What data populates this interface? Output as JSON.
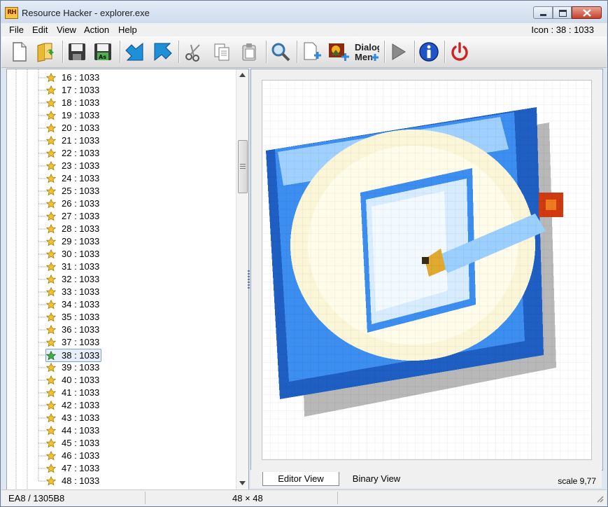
{
  "window": {
    "title": "Resource Hacker - explorer.exe",
    "app_icon_text": "RH"
  },
  "menu": {
    "items": [
      "File",
      "Edit",
      "View",
      "Action",
      "Help"
    ],
    "selection_info": "Icon : 38 : 1033"
  },
  "toolbar": {
    "buttons": [
      "new-file-icon",
      "open-folder-icon",
      "save-icon",
      "save-as-icon",
      "back-arrow-icon",
      "forward-arrow-icon",
      "cut-icon",
      "copy-icon",
      "paste-icon",
      "search-icon",
      "add-resource-icon",
      "add-image-resource-icon",
      "dialog-menu-icon",
      "run-script-icon",
      "info-icon",
      "power-icon"
    ],
    "save_as_label": "As",
    "dialog_menu_label_1": "Dialog",
    "dialog_menu_label_2": "Men"
  },
  "tree": {
    "items": [
      "16 : 1033",
      "17 : 1033",
      "18 : 1033",
      "19 : 1033",
      "20 : 1033",
      "21 : 1033",
      "22 : 1033",
      "23 : 1033",
      "24 : 1033",
      "25 : 1033",
      "26 : 1033",
      "27 : 1033",
      "28 : 1033",
      "29 : 1033",
      "30 : 1033",
      "31 : 1033",
      "32 : 1033",
      "33 : 1033",
      "34 : 1033",
      "35 : 1033",
      "36 : 1033",
      "37 : 1033",
      "38 : 1033",
      "39 : 1033",
      "40 : 1033",
      "41 : 1033",
      "42 : 1033",
      "43 : 1033",
      "44 : 1033",
      "45 : 1033",
      "46 : 1033",
      "47 : 1033",
      "48 : 1033"
    ],
    "selected": "38 : 1033"
  },
  "tabs": {
    "editor": "Editor View",
    "binary": "Binary View"
  },
  "scale": "scale 9,77",
  "status": {
    "offset": "EA8 / 1305B8",
    "size": "48 × 48"
  },
  "colors": {
    "accent": "#3b7bd4",
    "selected_star": "#3fae4a",
    "star": "#f2c230",
    "close_button": "#c7402b",
    "power": "#d02020",
    "info": "#1f55c8"
  }
}
